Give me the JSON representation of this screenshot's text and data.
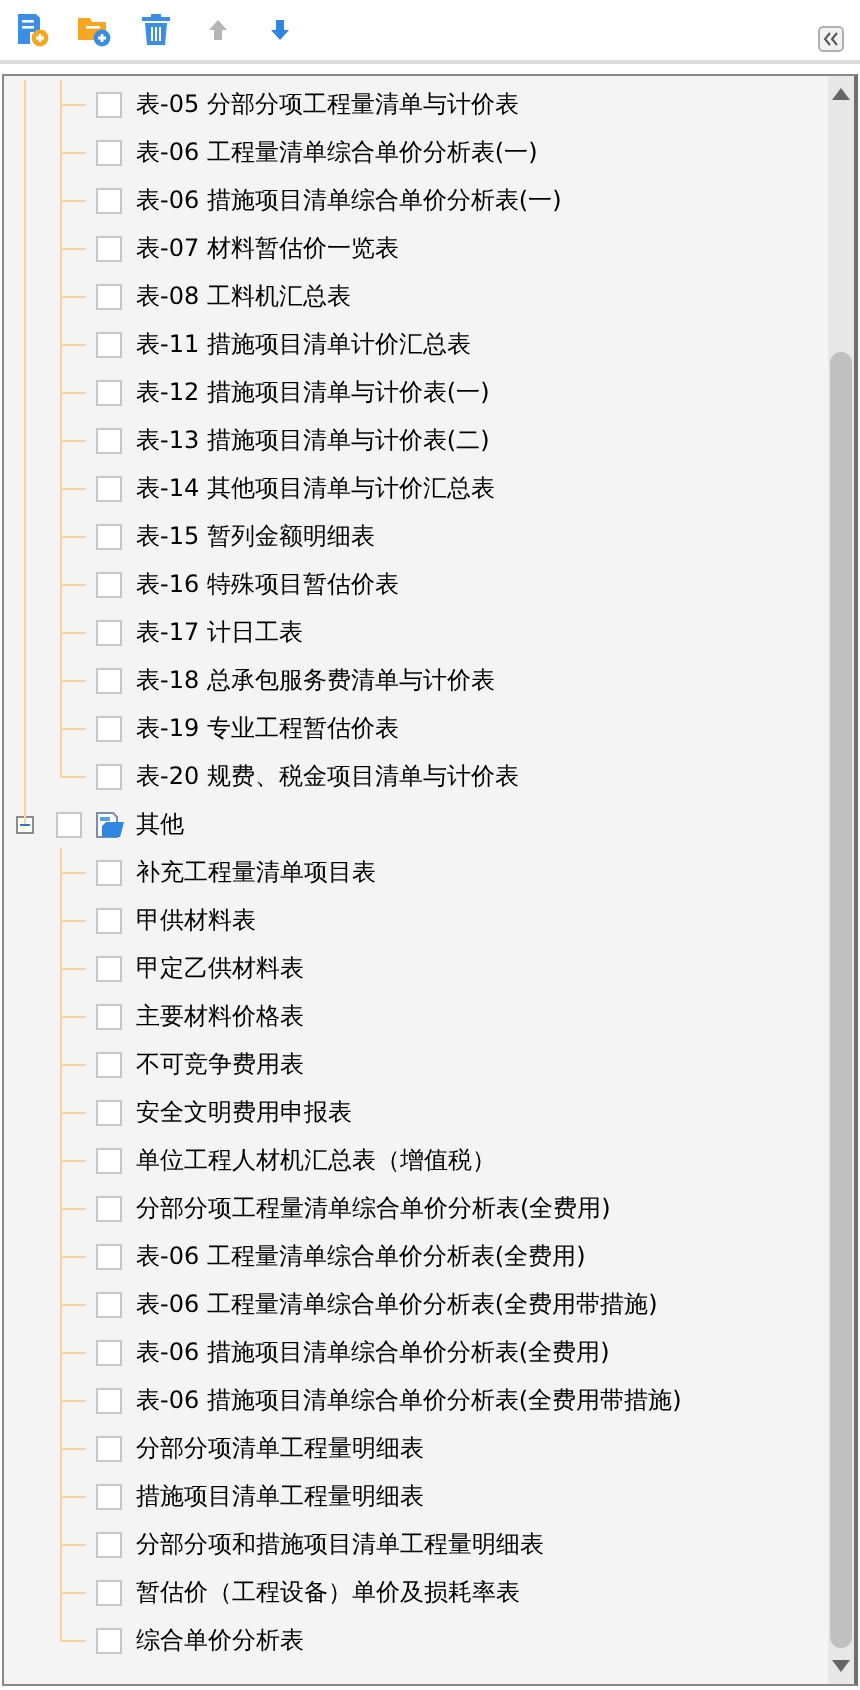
{
  "tree": {
    "groups": [
      {
        "children": [
          {
            "label": "表-05 分部分项工程量清单与计价表",
            "checked": false
          },
          {
            "label": "表-06 工程量清单综合单价分析表(一)",
            "checked": false
          },
          {
            "label": "表-06 措施项目清单综合单价分析表(一)",
            "checked": false
          },
          {
            "label": "表-07 材料暂估价一览表",
            "checked": false
          },
          {
            "label": "表-08 工料机汇总表",
            "checked": false
          },
          {
            "label": "表-11 措施项目清单计价汇总表",
            "checked": false
          },
          {
            "label": "表-12 措施项目清单与计价表(一)",
            "checked": false
          },
          {
            "label": "表-13 措施项目清单与计价表(二)",
            "checked": false
          },
          {
            "label": "表-14 其他项目清单与计价汇总表",
            "checked": false
          },
          {
            "label": "表-15 暂列金额明细表",
            "checked": false
          },
          {
            "label": "表-16 特殊项目暂估价表",
            "checked": false
          },
          {
            "label": "表-17 计日工表",
            "checked": false
          },
          {
            "label": "表-18 总承包服务费清单与计价表",
            "checked": false
          },
          {
            "label": "表-19 专业工程暂估价表",
            "checked": false
          },
          {
            "label": "表-20 规费、税金项目清单与计价表",
            "checked": false
          }
        ]
      },
      {
        "label": "其他",
        "expanded": true,
        "checked": false,
        "children": [
          {
            "label": "补充工程量清单项目表",
            "checked": false
          },
          {
            "label": "甲供材料表",
            "checked": false
          },
          {
            "label": "甲定乙供材料表",
            "checked": false
          },
          {
            "label": "主要材料价格表",
            "checked": false
          },
          {
            "label": "不可竞争费用表",
            "checked": false
          },
          {
            "label": "安全文明费用申报表",
            "checked": false
          },
          {
            "label": "单位工程人材机汇总表（增值税）",
            "checked": false
          },
          {
            "label": "分部分项工程量清单综合单价分析表(全费用)",
            "checked": false
          },
          {
            "label": "表-06 工程量清单综合单价分析表(全费用)",
            "checked": false
          },
          {
            "label": "表-06 工程量清单综合单价分析表(全费用带措施)",
            "checked": false
          },
          {
            "label": "表-06 措施项目清单综合单价分析表(全费用)",
            "checked": false
          },
          {
            "label": "表-06 措施项目清单综合单价分析表(全费用带措施)",
            "checked": false
          },
          {
            "label": "分部分项清单工程量明细表",
            "checked": false
          },
          {
            "label": "措施项目清单工程量明细表",
            "checked": false
          },
          {
            "label": "分部分项和措施项目清单工程量明细表",
            "checked": false
          },
          {
            "label": "暂估价（工程设备）单价及损耗率表",
            "checked": false
          },
          {
            "label": "综合单价分析表",
            "checked": false
          }
        ]
      }
    ]
  }
}
